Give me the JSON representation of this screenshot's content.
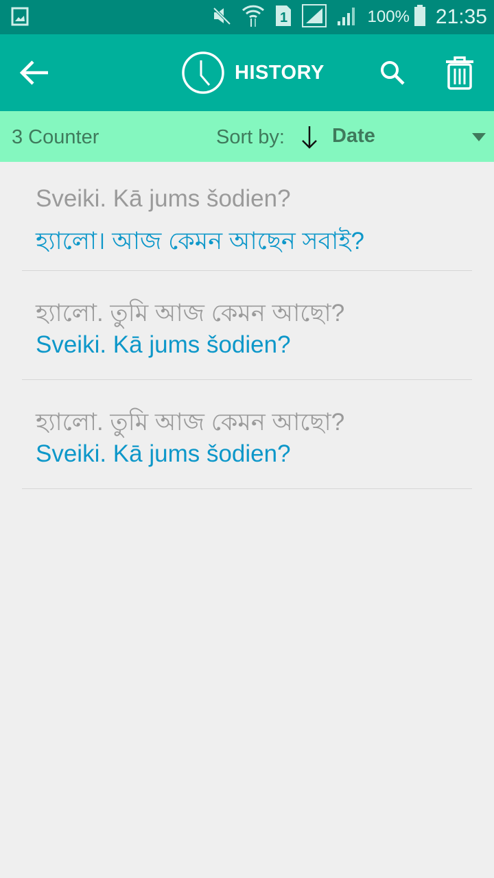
{
  "status_bar": {
    "icons": [
      "gallery-icon",
      "mute-icon",
      "wifi-icon",
      "sim1-icon",
      "signal-icon",
      "signal-icon"
    ],
    "battery": "100%",
    "time": "21:35"
  },
  "app_bar": {
    "title": "HISTORY",
    "icons": {
      "back": "arrow-left-icon",
      "title": "clock-icon",
      "search": "search-icon",
      "delete": "trash-icon"
    },
    "background_color": "#00b09b"
  },
  "sort_bar": {
    "counter": "3 Counter",
    "sort_label": "Sort by:",
    "sort_direction": "descending",
    "sort_value": "Date",
    "background_color": "#84f7bf"
  },
  "history": [
    {
      "source": "Sveiki. Kā jums šodien?",
      "translation": "হ্যালো। আজ কেমন আছেন সবাই?"
    },
    {
      "source": "হ্যালো. তুমি আজ কেমন আছো?",
      "translation": "Sveiki. Kā jums šodien?"
    },
    {
      "source": "হ্যালো. তুমি আজ কেমন আছো?",
      "translation": "Sveiki. Kā jums šodien?"
    }
  ],
  "colors": {
    "source_text": "#9a9a9a",
    "translation_text": "#0d97c9",
    "status_bar": "#00897b"
  }
}
